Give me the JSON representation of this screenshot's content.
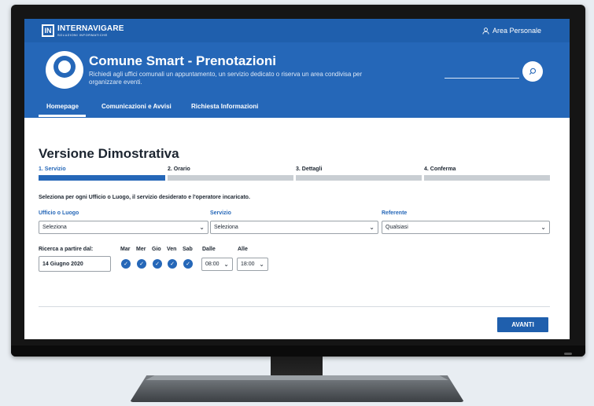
{
  "topbar": {
    "logo_box": "IN",
    "logo_name": "INTERNAVIGARE",
    "logo_sub": "SOLUZIONI INFORMATICHE",
    "area_personale": "Area Personale"
  },
  "hero": {
    "title": "Comune Smart - Prenotazioni",
    "subtitle": "Richiedi agli uffici comunali un appuntamento, un servizio dedicato o riserva un area condivisa per organizzare eventi."
  },
  "nav": {
    "items": [
      {
        "label": "Homepage"
      },
      {
        "label": "Comunicazioni e Avvisi"
      },
      {
        "label": "Richiesta Informazioni"
      }
    ]
  },
  "main": {
    "title": "Versione Dimostrativa",
    "steps": [
      {
        "label": "1. Servizio",
        "active": true
      },
      {
        "label": "2. Orario",
        "active": false
      },
      {
        "label": "3. Dettagli",
        "active": false
      },
      {
        "label": "4. Conferma",
        "active": false
      }
    ],
    "intro": "Seleziona per ogni Ufficio o Luogo, il servizio desiderato e l'operatore incaricato.",
    "fields": {
      "ufficio_label": "Ufficio o Luogo",
      "ufficio_value": "Seleziona",
      "servizio_label": "Servizio",
      "servizio_value": "Seleziona",
      "referente_label": "Referente",
      "referente_value": "Qualsiasi"
    },
    "ricerca": {
      "label": "Ricerca a partire dal:",
      "date": "14 Giugno 2020"
    },
    "days": [
      "Mar",
      "Mer",
      "Gio",
      "Ven",
      "Sab"
    ],
    "dalle_label": "Dalle",
    "dalle_value": "08:00",
    "alle_label": "Alle",
    "alle_value": "18:00",
    "next_label": "AVANTI"
  },
  "colors": {
    "primary": "#1f5fad",
    "hero": "#2567b8",
    "inactive_step": "#c9ced3"
  }
}
